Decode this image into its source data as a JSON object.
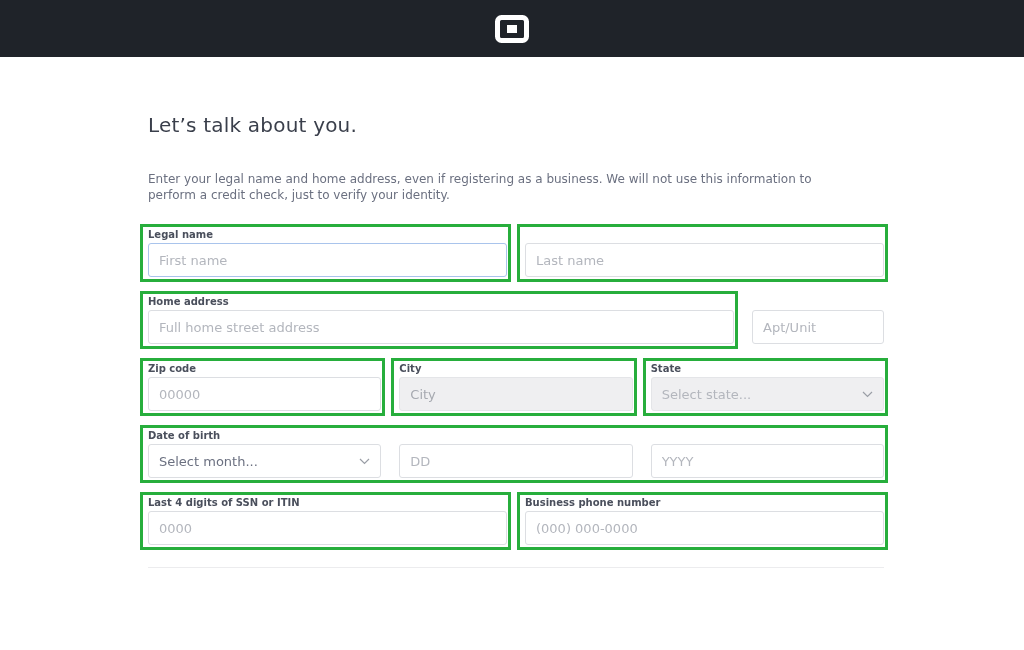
{
  "title": "Let’s talk about you.",
  "description": "Enter your legal name and home address, even if registering as a business. We will not use this information to perform a credit check, just to verify your identity.",
  "rows": [
    {
      "kind": "pair",
      "groups": [
        {
          "label": "Legal name",
          "highlighted": true,
          "fields": [
            {
              "kind": "text",
              "placeholder": "First name",
              "focused": true,
              "disabled": false
            }
          ]
        },
        {
          "highlighted": true,
          "fields": [
            {
              "kind": "text",
              "placeholder": "Last name",
              "focused": false,
              "disabled": false
            }
          ]
        }
      ]
    },
    {
      "kind": "address",
      "groups": [
        {
          "label": "Home address",
          "highlighted": true,
          "fields": [
            {
              "kind": "text",
              "placeholder": "Full home street address",
              "focused": false,
              "disabled": false
            }
          ]
        },
        {
          "highlighted": false,
          "fields": [
            {
              "kind": "text",
              "placeholder": "Apt/Unit",
              "focused": false,
              "disabled": false
            }
          ]
        }
      ]
    },
    {
      "kind": "triple",
      "groups": [
        {
          "label": "Zip code",
          "highlighted": true,
          "fields": [
            {
              "kind": "text",
              "placeholder": "00000",
              "focused": false,
              "disabled": false
            }
          ]
        },
        {
          "label": "City",
          "highlighted": true,
          "fields": [
            {
              "kind": "text",
              "placeholder": "City",
              "focused": false,
              "disabled": true
            }
          ]
        },
        {
          "label": "State",
          "highlighted": true,
          "fields": [
            {
              "kind": "select",
              "placeholder": "Select state...",
              "focused": false,
              "disabled": true
            }
          ]
        }
      ]
    },
    {
      "kind": "full",
      "groups": [
        {
          "label": "Date of birth",
          "highlighted": true,
          "fields": [
            {
              "kind": "select",
              "placeholder": "Select month...",
              "focused": false,
              "disabled": false
            },
            {
              "kind": "text",
              "placeholder": "DD",
              "focused": false,
              "disabled": false
            },
            {
              "kind": "text",
              "placeholder": "YYYY",
              "focused": false,
              "disabled": false
            }
          ]
        }
      ]
    },
    {
      "kind": "pair",
      "groups": [
        {
          "label": "Last 4 digits of SSN or ITIN",
          "highlighted": true,
          "fields": [
            {
              "kind": "text",
              "placeholder": "0000",
              "focused": false,
              "disabled": false
            }
          ]
        },
        {
          "label": "Business phone number",
          "highlighted": true,
          "fields": [
            {
              "kind": "text",
              "placeholder": "(000) 000-0000",
              "focused": false,
              "disabled": false
            }
          ]
        }
      ]
    }
  ]
}
